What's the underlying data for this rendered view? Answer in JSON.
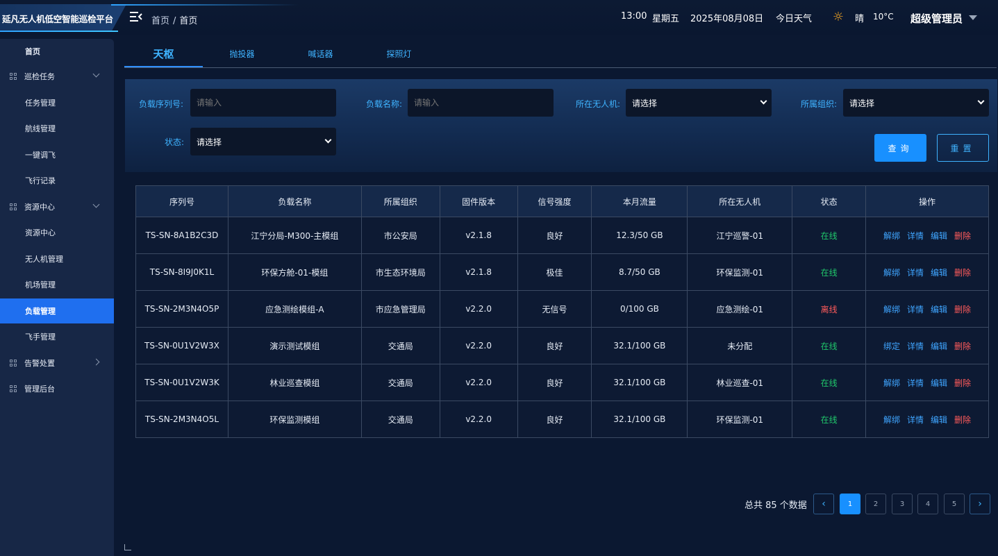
{
  "app": {
    "title": "延凡无人机低空智能巡检平台"
  },
  "breadcrumb": {
    "home": "首页",
    "separator": "/",
    "current": "首页"
  },
  "status": {
    "time": "13:00",
    "weekday": "星期五",
    "date": "2025年08月08日",
    "weather_label": "今日天气",
    "weather": "晴",
    "temperature": "10°C",
    "user": "超级管理员"
  },
  "sidebar": {
    "items": [
      {
        "label": "首页"
      },
      {
        "label": "巡检任务"
      },
      {
        "label": "任务管理"
      },
      {
        "label": "航线管理"
      },
      {
        "label": "一键调飞"
      },
      {
        "label": "飞行记录"
      },
      {
        "label": "资源中心"
      },
      {
        "label": "资源中心"
      },
      {
        "label": "无人机管理"
      },
      {
        "label": "机场管理"
      },
      {
        "label": "负载管理"
      },
      {
        "label": "飞手管理"
      },
      {
        "label": "告警处置"
      },
      {
        "label": "管理后台"
      }
    ]
  },
  "tabs": [
    {
      "label": "天枢"
    },
    {
      "label": "抛投器"
    },
    {
      "label": "喊话器"
    },
    {
      "label": "探照灯"
    }
  ],
  "filter": {
    "serial_label": "负载序列号:",
    "serial_placeholder": "请输入",
    "name_label": "负载名称:",
    "name_placeholder": "请输入",
    "drone_label": "所在无人机:",
    "drone_value": "请选择",
    "org_label": "所属组织:",
    "org_value": "请选择",
    "status_label": "状态:",
    "status_value": "请选择",
    "query_button": "查询",
    "reset_button": "重置"
  },
  "table": {
    "headers": [
      "序列号",
      "负载名称",
      "所属组织",
      "固件版本",
      "信号强度",
      "本月流量",
      "所在无人机",
      "状态",
      "操作"
    ],
    "rows": [
      {
        "serial": "TS-SN-8A1B2C3D",
        "name": "江宁分局-M300-主模组",
        "org": "市公安局",
        "fw": "v2.1.8",
        "signal": "良好",
        "traffic": "12.3/50 GB",
        "drone": "江宁巡警-01",
        "status": "在线",
        "op1": "解绑",
        "op2": "详情",
        "op3": "编辑",
        "op4": "删除"
      },
      {
        "serial": "TS-SN-8I9J0K1L",
        "name": "环保方舱-01-模组",
        "org": "市生态环境局",
        "fw": "v2.1.8",
        "signal": "极佳",
        "traffic": "8.7/50 GB",
        "drone": "环保监测-01",
        "status": "在线",
        "op1": "解绑",
        "op2": "详情",
        "op3": "编辑",
        "op4": "删除"
      },
      {
        "serial": "TS-SN-2M3N4O5P",
        "name": "应急测绘模组-A",
        "org": "市应急管理局",
        "fw": "v2.2.0",
        "signal": "无信号",
        "traffic": "0/100 GB",
        "drone": "应急测绘-01",
        "status": "离线",
        "op1": "解绑",
        "op2": "详情",
        "op3": "编辑",
        "op4": "删除"
      },
      {
        "serial": "TS-SN-0U1V2W3X",
        "name": "演示测试模组",
        "org": "交通局",
        "fw": "v2.2.0",
        "signal": "良好",
        "traffic": "32.1/100 GB",
        "drone": "未分配",
        "status": "在线",
        "op1": "绑定",
        "op2": "详情",
        "op3": "编辑",
        "op4": "删除"
      },
      {
        "serial": "TS-SN-0U1V2W3K",
        "name": "林业巡查模组",
        "org": "交通局",
        "fw": "v2.2.0",
        "signal": "良好",
        "traffic": "32.1/100 GB",
        "drone": "林业巡查-01",
        "status": "在线",
        "op1": "解绑",
        "op2": "详情",
        "op3": "编辑",
        "op4": "删除"
      },
      {
        "serial": "TS-SN-2M3N4O5L",
        "name": "环保监测模组",
        "org": "交通局",
        "fw": "v2.2.0",
        "signal": "良好",
        "traffic": "32.1/100 GB",
        "drone": "环保监测-01",
        "status": "在线",
        "op1": "解绑",
        "op2": "详情",
        "op3": "编辑",
        "op4": "删除"
      }
    ]
  },
  "pagination": {
    "total": "总共 85 个数据",
    "pages": [
      "1",
      "2",
      "3",
      "4",
      "5"
    ],
    "prev": "‹",
    "next": "›"
  },
  "colors": {
    "accent": "#1890ff",
    "online": "#20c76b",
    "offline": "#ff5b5b",
    "background": "#0b1831"
  }
}
